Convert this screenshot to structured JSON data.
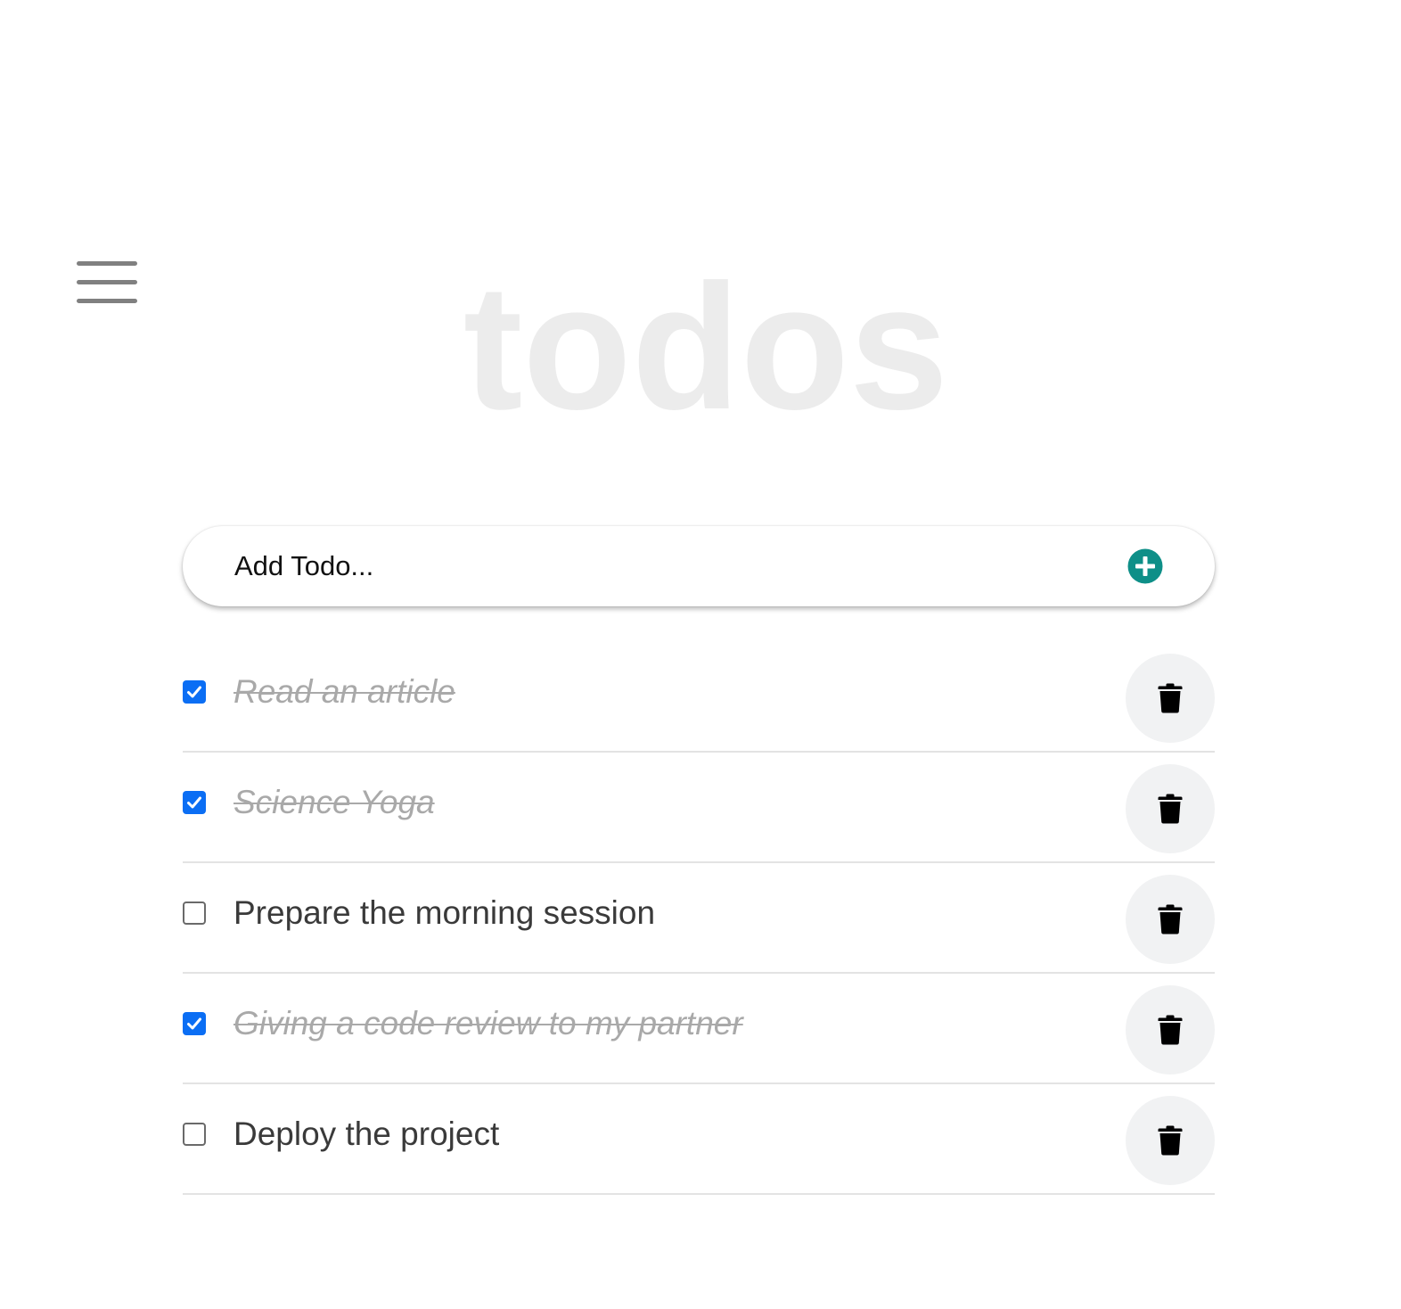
{
  "app": {
    "title": "todos"
  },
  "add_todo": {
    "placeholder": "Add Todo...",
    "accent_color": "#0e8f88"
  },
  "todos": [
    {
      "text": "Read an article",
      "completed": true
    },
    {
      "text": "Science Yoga",
      "completed": true
    },
    {
      "text": "Prepare the morning session",
      "completed": false
    },
    {
      "text": "Giving a code review to my partner",
      "completed": true
    },
    {
      "text": "Deploy the project",
      "completed": false
    }
  ],
  "icons": {
    "menu": "hamburger-menu-icon",
    "add": "plus-circle-icon",
    "delete": "trash-icon",
    "check": "checkmark-icon"
  },
  "colors": {
    "checkbox_checked": "#0b6ef4",
    "title": "#ececec",
    "completed_text": "#a9a9a9",
    "active_text": "#3a3a3a",
    "delete_button_bg": "#f1f2f3"
  }
}
